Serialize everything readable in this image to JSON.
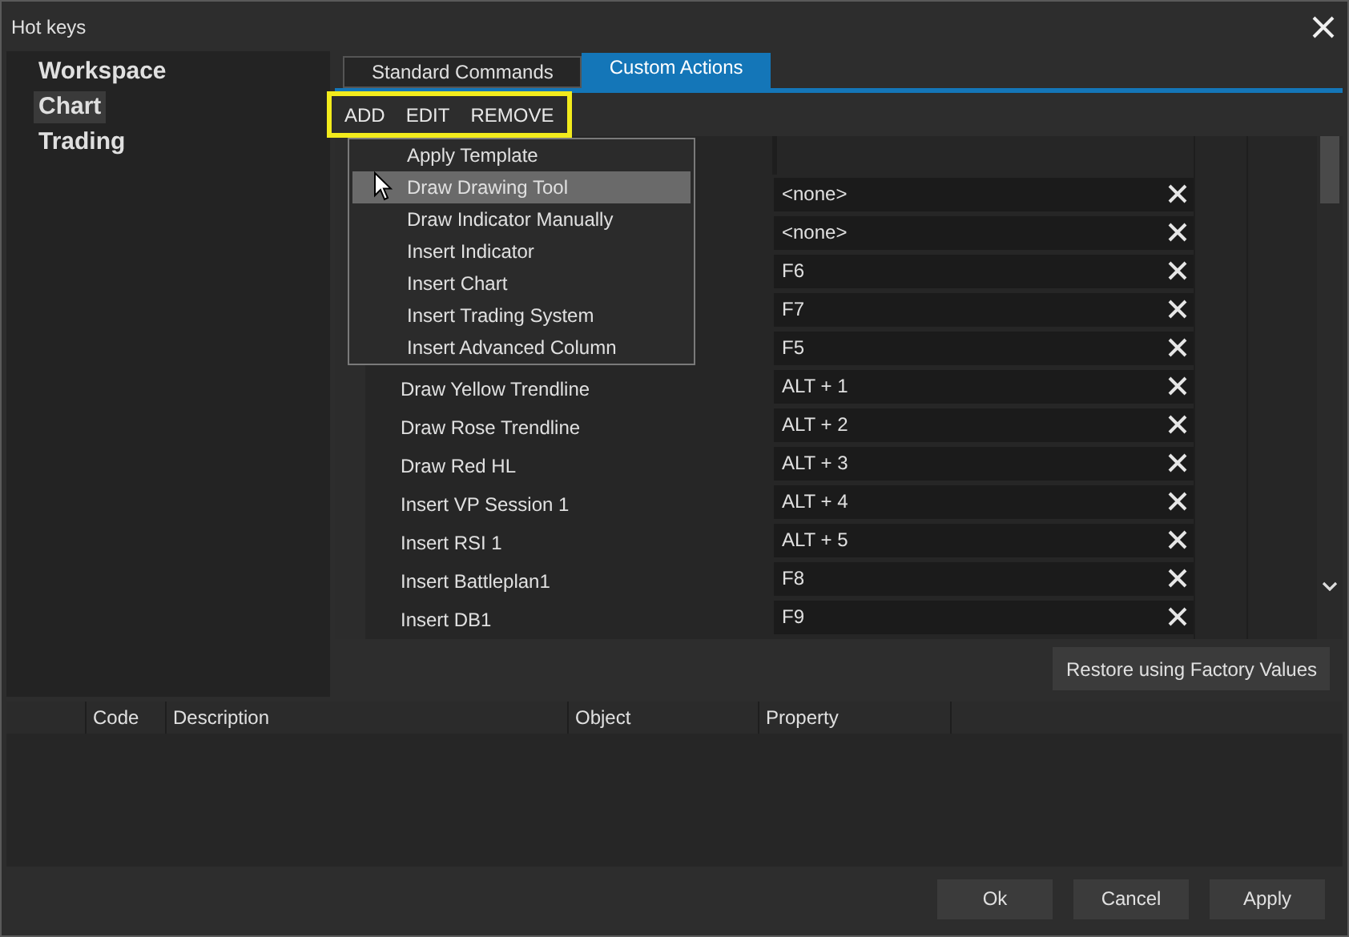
{
  "window": {
    "title": "Hot keys"
  },
  "sidebar": {
    "items": [
      {
        "label": "Workspace",
        "selected": false
      },
      {
        "label": "Chart",
        "selected": true
      },
      {
        "label": "Trading",
        "selected": false
      }
    ]
  },
  "tabs": [
    {
      "label": "Standard Commands",
      "selected": false
    },
    {
      "label": "Custom Actions",
      "selected": true
    }
  ],
  "toolbar": {
    "buttons": [
      "ADD",
      "EDIT",
      "REMOVE"
    ]
  },
  "menu": {
    "items": [
      {
        "label": "Apply Template",
        "selected": false
      },
      {
        "label": "Draw Drawing Tool",
        "selected": true
      },
      {
        "label": "Draw Indicator Manually",
        "selected": false
      },
      {
        "label": "Insert Indicator",
        "selected": false
      },
      {
        "label": "Insert Chart",
        "selected": false
      },
      {
        "label": "Insert Trading System",
        "selected": false
      },
      {
        "label": "Insert Advanced Column",
        "selected": false
      }
    ]
  },
  "hotkeys": {
    "rows": [
      {
        "value": "<none>"
      },
      {
        "value": "<none>"
      },
      {
        "value": "F6"
      },
      {
        "value": "F7"
      },
      {
        "value": "F5"
      },
      {
        "name": "Draw Yellow Trendline",
        "value": "ALT + 1"
      },
      {
        "name": "Draw Rose Trendline",
        "value": "ALT + 2"
      },
      {
        "name": "Draw Red HL",
        "value": "ALT + 3"
      },
      {
        "name": "Insert VP Session 1",
        "value": "ALT + 4"
      },
      {
        "name": "Insert RSI 1",
        "value": "ALT + 5"
      },
      {
        "name": "Insert Battleplan1",
        "value": "F8"
      },
      {
        "name": "Insert DB1",
        "value": "F9"
      }
    ]
  },
  "restore_button": "Restore using Factory Values",
  "details_table": {
    "columns": [
      "Code",
      "Description",
      "Object",
      "Property"
    ]
  },
  "buttons": [
    "Ok",
    "Cancel",
    "Apply"
  ]
}
